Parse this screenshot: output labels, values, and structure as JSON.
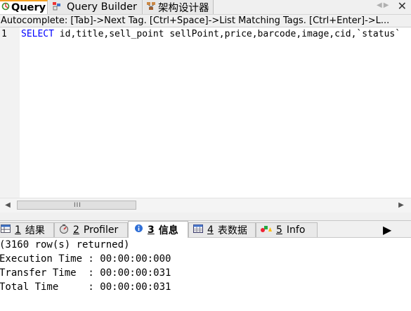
{
  "top_tabs": [
    {
      "label": "Query",
      "icon": "query-icon"
    },
    {
      "label": "Query Builder",
      "icon": "query-builder-icon"
    },
    {
      "label": "架构设计器",
      "icon": "schema-designer-icon"
    }
  ],
  "autocomplete": "Autocomplete: [Tab]->Next Tag. [Ctrl+Space]->List Matching Tags. [Ctrl+Enter]->L...",
  "editor": {
    "line_number": "1",
    "keyword": "SELECT",
    "code_rest": " id,title,sell_point sellPoint,price,barcode,image,cid,`status`"
  },
  "scrollbar": {
    "grip": "III"
  },
  "bottom_tabs": [
    {
      "num": "1",
      "label": "结果",
      "icon": "result-grid-icon"
    },
    {
      "num": "2",
      "label": "Profiler",
      "icon": "profiler-icon"
    },
    {
      "num": "3",
      "label": "信息",
      "icon": "info-icon"
    },
    {
      "num": "4",
      "label": "表数据",
      "icon": "table-data-icon"
    },
    {
      "num": "5",
      "label": "Info",
      "icon": "info-shapes-icon"
    }
  ],
  "results": [
    "(3160 row(s) returned)",
    "Execution Time : 00:00:00:000",
    "Transfer Time  : 00:00:00:031",
    "Total Time     : 00:00:00:031"
  ],
  "colors": {
    "keyword": "#0000ff",
    "active_tab_accent": "#f5a020"
  }
}
